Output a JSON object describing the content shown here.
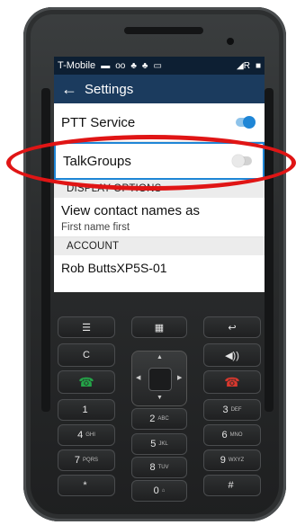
{
  "status_bar": {
    "carrier": "T-Mobile",
    "icons": [
      "message-icon",
      "voicemail-icon",
      "android-icon",
      "android-icon",
      "image-icon",
      "signal-icon",
      "battery-icon"
    ]
  },
  "app_bar": {
    "back_icon": "←",
    "title": "Settings"
  },
  "settings": {
    "ptt_service": {
      "label": "PTT Service",
      "enabled": true
    },
    "talkgroups": {
      "label": "TalkGroups",
      "enabled": false
    },
    "display_options_header": "DISPLAY OPTIONS",
    "view_contact_names": {
      "label": "View contact names as",
      "value": "First name first"
    },
    "account_header": "ACCOUNT",
    "account_name": "Rob ButtsXP5S-01"
  },
  "keypad": {
    "row0": [
      "☰",
      "▦",
      "↩"
    ],
    "c_key": "C",
    "volume_key": "◀))",
    "digits": [
      {
        "digit": "1",
        "sub": ""
      },
      {
        "digit": "2",
        "sub": "ABC"
      },
      {
        "digit": "3",
        "sub": "DEF"
      },
      {
        "digit": "4",
        "sub": "GHI"
      },
      {
        "digit": "5",
        "sub": "JKL"
      },
      {
        "digit": "6",
        "sub": "MNO"
      },
      {
        "digit": "7",
        "sub": "PQRS"
      },
      {
        "digit": "8",
        "sub": "TUV"
      },
      {
        "digit": "9",
        "sub": "WXYZ"
      },
      {
        "digit": "*",
        "sub": ""
      },
      {
        "digit": "0",
        "sub": "⌂"
      },
      {
        "digit": "#",
        "sub": ""
      }
    ]
  },
  "colors": {
    "accent": "#1f86d6",
    "app_bar": "#1b3b5e",
    "status_bar": "#0d1f33",
    "annotation": "#e01515"
  }
}
